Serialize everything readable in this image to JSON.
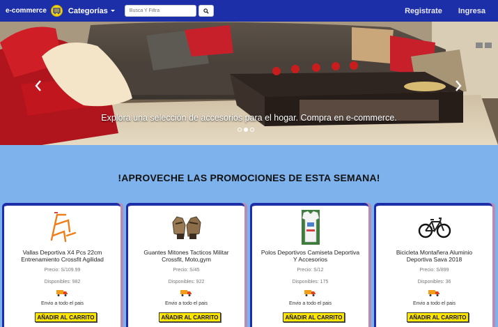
{
  "navbar": {
    "brand": "e-commerce",
    "categories_label": "Categorías",
    "search_placeholder": "Busca Y Filtra",
    "register_label": "Registrate",
    "login_label": "Ingresa"
  },
  "carousel": {
    "caption": "Explora una selección de accesorios para el hogar. Compra en e-commerce.",
    "slides": 3,
    "active_slide": 2
  },
  "promo": {
    "title": "!APROVECHE LAS PROMOCIONES DE ESTA SEMANA!",
    "products": [
      {
        "title": "Vallas Deportiva X4 Pcs 22cm Entrenamiento Crossfit Agilidad",
        "price": "Precio: S/109.99",
        "available": "Disponibles: 982",
        "shipping": "Envio a todo el pais",
        "button": "AÑADIR AL CARRITO",
        "icon": "hurdle-icon"
      },
      {
        "title": "Guantes Mitones Tacticos Militar Crossfit, Moto,gym",
        "price": "Precio: S/45",
        "available": "Disponibles: 922",
        "shipping": "Envio a todo el pais",
        "button": "AÑADIR AL CARRITO",
        "icon": "gloves-icon"
      },
      {
        "title": "Polos Deportivos Camiseta Deportiva Y Accesorios",
        "price": "Precio: S/12",
        "available": "Disponibles: 175",
        "shipping": "Envio a todo el pais",
        "button": "AÑADIR AL CARRITO",
        "icon": "shirt-icon"
      },
      {
        "title": "Bicicleta Montañera Aluminio Deportiva Sava 2018",
        "price": "Precio: S/899",
        "available": "Disponibles: 36",
        "shipping": "Envio a todo el pais",
        "button": "AÑADIR AL CARRITO",
        "icon": "bicycle-icon"
      }
    ]
  },
  "colors": {
    "navbar": "#1d2fa8",
    "background": "#7db2ec",
    "button": "#ffe600"
  }
}
